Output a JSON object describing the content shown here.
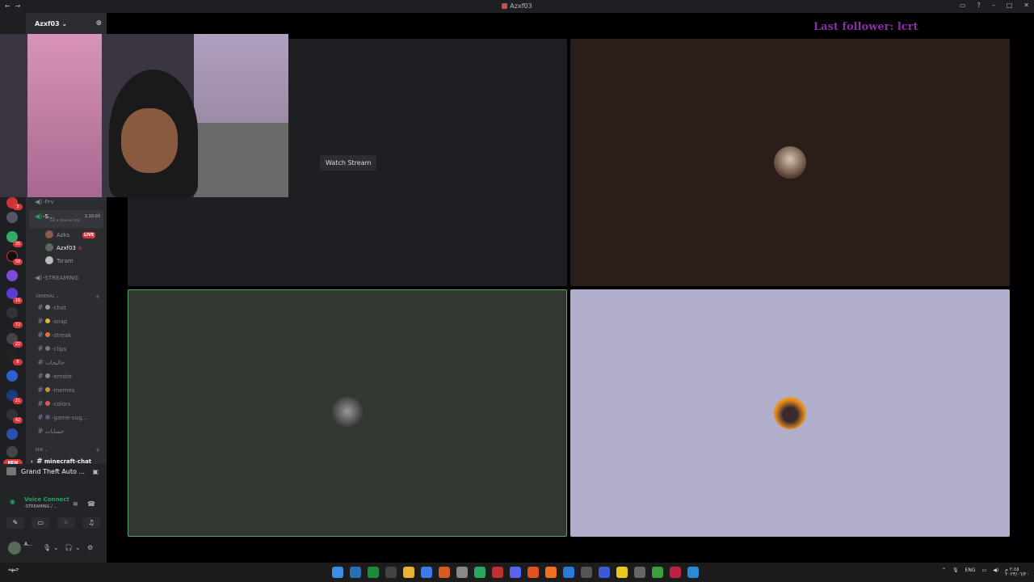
{
  "window": {
    "title": "Azxf03",
    "nav_back": "←",
    "nav_forward": "→",
    "controls": [
      "▭",
      "?",
      "–",
      "□",
      "✕"
    ]
  },
  "server_rail": {
    "badges": [
      "3",
      "35",
      "58",
      "16",
      "72",
      "22",
      "8",
      "21",
      "42"
    ],
    "new_label": "NEW"
  },
  "guild": {
    "name": "Azxf03 ⌄",
    "invite_icon": "add-user-icon"
  },
  "channels": {
    "prv": "-Prv",
    "active_voice": {
      "name": "-S...",
      "time": "1:10:03",
      "status": "Set a channel stat..."
    },
    "members": [
      {
        "name": "Azks",
        "live": "LIVE"
      },
      {
        "name": "Azxf03",
        "tag": "A"
      },
      {
        "name": "Tsram"
      }
    ],
    "streaming": "-STREAMING",
    "category_general": "GENERAL",
    "text_channels": [
      "-chat",
      "-snap",
      "-streak",
      "-clips",
      "خاليجات",
      "-emote",
      "-memes",
      "-colors",
      "-game-sug...",
      "حسابات"
    ],
    "category_min": "Min",
    "minecraft": "minecraft-chat"
  },
  "activity": {
    "game": "Grand Theft Auto ..."
  },
  "voice": {
    "title": "Voice Connect",
    "subtitle": "-STREAMING / ..."
  },
  "user": {
    "name": "A..."
  },
  "stage": {
    "watch_stream": "Watch Stream",
    "last_follower": "Last follower: lcrt",
    "tiles": [
      {
        "name": "stream-tile",
        "bg": "#1e1f23"
      },
      {
        "name": "user-tile-1",
        "bg": "#2b1d1a"
      },
      {
        "name": "user-tile-2",
        "bg": "#323832",
        "border": "#57a35a"
      },
      {
        "name": "user-tile-3",
        "bg": "#b1aecb"
      }
    ]
  },
  "taskbar": {
    "left_text": "جبهه",
    "lang": "ENG",
    "time": "٢:٤٥ م",
    "date": "٢٠٢٣/٠٦/٢٠"
  }
}
